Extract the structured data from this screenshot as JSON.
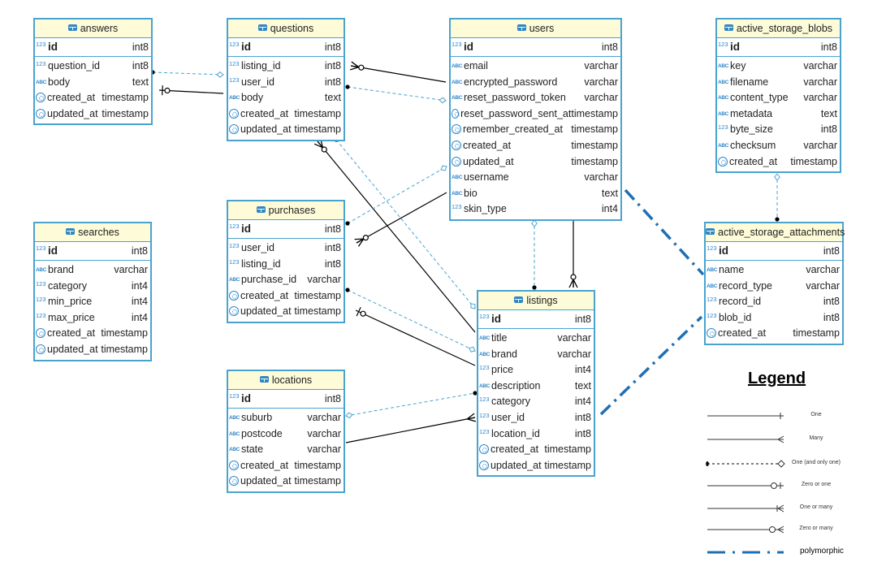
{
  "diagram": {
    "type": "entity-relationship",
    "tables": [
      {
        "key": "answers",
        "name": "answers",
        "pk": {
          "name": "id",
          "type": "int8",
          "icon": "number"
        },
        "columns": [
          {
            "name": "question_id",
            "type": "int8",
            "icon": "number"
          },
          {
            "name": "body",
            "type": "text",
            "icon": "text"
          },
          {
            "name": "created_at",
            "type": "timestamp",
            "icon": "clock"
          },
          {
            "name": "updated_at",
            "type": "timestamp",
            "icon": "clock"
          }
        ]
      },
      {
        "key": "questions",
        "name": "questions",
        "pk": {
          "name": "id",
          "type": "int8",
          "icon": "number"
        },
        "columns": [
          {
            "name": "listing_id",
            "type": "int8",
            "icon": "number"
          },
          {
            "name": "user_id",
            "type": "int8",
            "icon": "number"
          },
          {
            "name": "body",
            "type": "text",
            "icon": "text"
          },
          {
            "name": "created_at",
            "type": "timestamp",
            "icon": "clock"
          },
          {
            "name": "updated_at",
            "type": "timestamp",
            "icon": "clock"
          }
        ]
      },
      {
        "key": "users",
        "name": "users",
        "pk": {
          "name": "id",
          "type": "int8",
          "icon": "number"
        },
        "columns": [
          {
            "name": "email",
            "type": "varchar",
            "icon": "text"
          },
          {
            "name": "encrypted_password",
            "type": "varchar",
            "icon": "text"
          },
          {
            "name": "reset_password_token",
            "type": "varchar",
            "icon": "text"
          },
          {
            "name": "reset_password_sent_at",
            "type": "timestamp",
            "icon": "clock"
          },
          {
            "name": "remember_created_at",
            "type": "timestamp",
            "icon": "clock"
          },
          {
            "name": "created_at",
            "type": "timestamp",
            "icon": "clock"
          },
          {
            "name": "updated_at",
            "type": "timestamp",
            "icon": "clock"
          },
          {
            "name": "username",
            "type": "varchar",
            "icon": "text"
          },
          {
            "name": "bio",
            "type": "text",
            "icon": "text"
          },
          {
            "name": "skin_type",
            "type": "int4",
            "icon": "number"
          }
        ]
      },
      {
        "key": "active_storage_blobs",
        "name": "active_storage_blobs",
        "pk": {
          "name": "id",
          "type": "int8",
          "icon": "number"
        },
        "columns": [
          {
            "name": "key",
            "type": "varchar",
            "icon": "text"
          },
          {
            "name": "filename",
            "type": "varchar",
            "icon": "text"
          },
          {
            "name": "content_type",
            "type": "varchar",
            "icon": "text"
          },
          {
            "name": "metadata",
            "type": "text",
            "icon": "text"
          },
          {
            "name": "byte_size",
            "type": "int8",
            "icon": "number"
          },
          {
            "name": "checksum",
            "type": "varchar",
            "icon": "text"
          },
          {
            "name": "created_at",
            "type": "timestamp",
            "icon": "clock"
          }
        ]
      },
      {
        "key": "searches",
        "name": "searches",
        "pk": {
          "name": "id",
          "type": "int8",
          "icon": "number"
        },
        "columns": [
          {
            "name": "brand",
            "type": "varchar",
            "icon": "text"
          },
          {
            "name": "category",
            "type": "int4",
            "icon": "number"
          },
          {
            "name": "min_price",
            "type": "int4",
            "icon": "number"
          },
          {
            "name": "max_price",
            "type": "int4",
            "icon": "number"
          },
          {
            "name": "created_at",
            "type": "timestamp",
            "icon": "clock"
          },
          {
            "name": "updated_at",
            "type": "timestamp",
            "icon": "clock"
          }
        ]
      },
      {
        "key": "purchases",
        "name": "purchases",
        "pk": {
          "name": "id",
          "type": "int8",
          "icon": "number"
        },
        "columns": [
          {
            "name": "user_id",
            "type": "int8",
            "icon": "number"
          },
          {
            "name": "listing_id",
            "type": "int8",
            "icon": "number"
          },
          {
            "name": "purchase_id",
            "type": "varchar",
            "icon": "text"
          },
          {
            "name": "created_at",
            "type": "timestamp",
            "icon": "clock"
          },
          {
            "name": "updated_at",
            "type": "timestamp",
            "icon": "clock"
          }
        ]
      },
      {
        "key": "active_storage_attachments",
        "name": "active_storage_attachments",
        "pk": {
          "name": "id",
          "type": "int8",
          "icon": "number"
        },
        "columns": [
          {
            "name": "name",
            "type": "varchar",
            "icon": "text"
          },
          {
            "name": "record_type",
            "type": "varchar",
            "icon": "text"
          },
          {
            "name": "record_id",
            "type": "int8",
            "icon": "number"
          },
          {
            "name": "blob_id",
            "type": "int8",
            "icon": "number"
          },
          {
            "name": "created_at",
            "type": "timestamp",
            "icon": "clock"
          }
        ]
      },
      {
        "key": "listings",
        "name": "listings",
        "pk": {
          "name": "id",
          "type": "int8",
          "icon": "number"
        },
        "columns": [
          {
            "name": "title",
            "type": "varchar",
            "icon": "text"
          },
          {
            "name": "brand",
            "type": "varchar",
            "icon": "text"
          },
          {
            "name": "price",
            "type": "int4",
            "icon": "number"
          },
          {
            "name": "description",
            "type": "text",
            "icon": "text"
          },
          {
            "name": "category",
            "type": "int4",
            "icon": "number"
          },
          {
            "name": "user_id",
            "type": "int8",
            "icon": "number"
          },
          {
            "name": "location_id",
            "type": "int8",
            "icon": "number"
          },
          {
            "name": "created_at",
            "type": "timestamp",
            "icon": "clock"
          },
          {
            "name": "updated_at",
            "type": "timestamp",
            "icon": "clock"
          }
        ]
      },
      {
        "key": "locations",
        "name": "locations",
        "pk": {
          "name": "id",
          "type": "int8",
          "icon": "number"
        },
        "columns": [
          {
            "name": "suburb",
            "type": "varchar",
            "icon": "text"
          },
          {
            "name": "postcode",
            "type": "varchar",
            "icon": "text"
          },
          {
            "name": "state",
            "type": "varchar",
            "icon": "text"
          },
          {
            "name": "created_at",
            "type": "timestamp",
            "icon": "clock"
          },
          {
            "name": "updated_at",
            "type": "timestamp",
            "icon": "clock"
          }
        ]
      }
    ],
    "relationships": [
      {
        "from": "answers",
        "to": "questions",
        "style": "dashed",
        "from_end": "one-and-only-one",
        "to_end": "diamond"
      },
      {
        "from": "answers",
        "to": "questions",
        "style": "solid",
        "from_end": "zero-or-one",
        "to_end": "none"
      },
      {
        "from": "questions",
        "to": "users",
        "style": "solid",
        "from_end": "zero-or-many",
        "to_end": "none"
      },
      {
        "from": "questions",
        "to": "users",
        "style": "dashed",
        "from_end": "one-and-only-one",
        "to_end": "diamond"
      },
      {
        "from": "questions",
        "to": "listings",
        "style": "solid",
        "from_end": "zero-or-many",
        "to_end": "none"
      },
      {
        "from": "questions",
        "to": "listings",
        "style": "dashed",
        "from_end": "one-and-only-one",
        "to_end": "diamond"
      },
      {
        "from": "purchases",
        "to": "users",
        "style": "dashed",
        "from_end": "one-and-only-one",
        "to_end": "diamond"
      },
      {
        "from": "purchases",
        "to": "users",
        "style": "solid",
        "from_end": "zero-or-many",
        "to_end": "none"
      },
      {
        "from": "purchases",
        "to": "listings",
        "style": "dashed",
        "from_end": "one-and-only-one",
        "to_end": "diamond"
      },
      {
        "from": "purchases",
        "to": "listings",
        "style": "solid",
        "from_end": "zero-or-one",
        "to_end": "none"
      },
      {
        "from": "users",
        "to": "listings",
        "style": "dashed",
        "from_end": "diamond",
        "to_end": "one-and-only-one"
      },
      {
        "from": "users",
        "to": "listings",
        "style": "solid",
        "from_end": "none",
        "to_end": "zero-or-many"
      },
      {
        "from": "locations",
        "to": "listings",
        "style": "dashed",
        "from_end": "diamond",
        "to_end": "one-and-only-one"
      },
      {
        "from": "locations",
        "to": "listings",
        "style": "solid",
        "from_end": "none",
        "to_end": "many"
      },
      {
        "from": "active_storage_blobs",
        "to": "active_storage_attachments",
        "style": "dashed",
        "from_end": "diamond",
        "to_end": "one-and-only-one"
      },
      {
        "from": "users",
        "to": "active_storage_attachments",
        "style": "polymorphic",
        "from_end": "none",
        "to_end": "none"
      },
      {
        "from": "listings",
        "to": "active_storage_attachments",
        "style": "polymorphic",
        "from_end": "none",
        "to_end": "none"
      }
    ]
  },
  "legend": {
    "title": "Legend",
    "items": [
      {
        "key": "one",
        "label": "One"
      },
      {
        "key": "many",
        "label": "Many"
      },
      {
        "key": "one-and-only-one",
        "label": "One (and only one)"
      },
      {
        "key": "zero-or-one",
        "label": "Zero or one"
      },
      {
        "key": "one-or-many",
        "label": "One or many"
      },
      {
        "key": "zero-or-many",
        "label": "Zero or many"
      },
      {
        "key": "polymorphic",
        "label": "polymorphic"
      }
    ]
  },
  "icons": {
    "number": "123",
    "text": "ABC",
    "clock": "clock-icon"
  },
  "colors": {
    "table_border": "#4aa3cf",
    "header_bg": "#fdfbd8",
    "icon": "#2f86c9",
    "dashed_link": "#4aa3cf",
    "polymorphic": "#1f6fb2",
    "solid_link": "#000000"
  }
}
